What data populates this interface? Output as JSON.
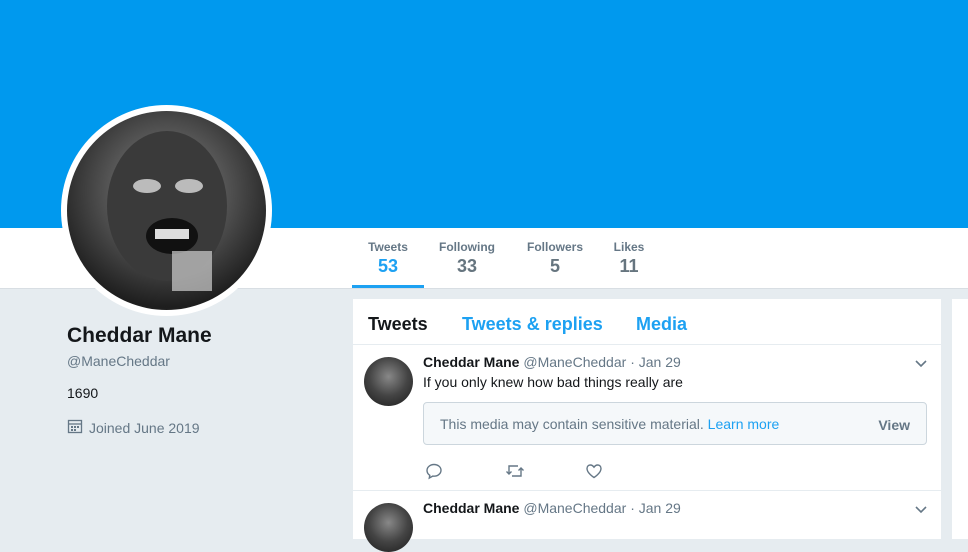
{
  "profile": {
    "name": "Cheddar Mane",
    "handle": "@ManeCheddar",
    "bio": "1690",
    "joined": "Joined June 2019"
  },
  "stats": [
    {
      "label": "Tweets",
      "value": "53"
    },
    {
      "label": "Following",
      "value": "33"
    },
    {
      "label": "Followers",
      "value": "5"
    },
    {
      "label": "Likes",
      "value": "11"
    }
  ],
  "tabs": [
    {
      "label": "Tweets"
    },
    {
      "label": "Tweets & replies"
    },
    {
      "label": "Media"
    }
  ],
  "tweets": [
    {
      "name": "Cheddar Mane",
      "handle": "@ManeCheddar",
      "date": "· Jan 29",
      "text": "If you only knew how bad things really are",
      "sensitive_msg": "This media may contain sensitive material.",
      "learn_more": "Learn more",
      "view": "View"
    },
    {
      "name": "Cheddar Mane",
      "handle": "@ManeCheddar",
      "date": "· Jan 29"
    }
  ],
  "colors": {
    "banner": "#0099ee",
    "accent": "#1da1f2",
    "background": "#e6ecf0"
  },
  "icons": [
    "calendar-icon",
    "chevron-down-icon",
    "reply-icon",
    "retweet-icon",
    "like-icon"
  ]
}
